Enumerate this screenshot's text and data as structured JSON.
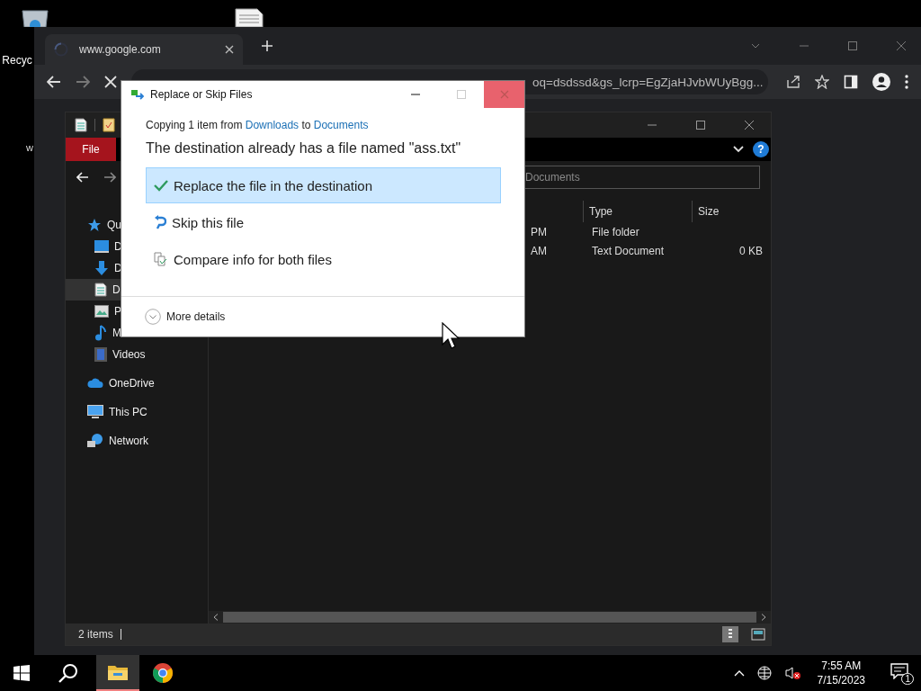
{
  "desktop": {
    "icons": [
      {
        "kind": "recycle",
        "label": "Recyc"
      },
      {
        "kind": "document"
      }
    ],
    "stray_label": "w"
  },
  "browser": {
    "tab": {
      "title": "www.google.com",
      "loading": true
    },
    "address": "oq=dsdssd&gs_lcrp=EgZjaHJvbWUyBgg..."
  },
  "explorer": {
    "ribbon_tab": "File",
    "help": "?",
    "search_placeholder": "Documents",
    "sidebar": [
      {
        "label": "Qu",
        "kind": "star",
        "selected": false,
        "children": [
          {
            "label": "D",
            "kind": "desktop",
            "selected": false
          },
          {
            "label": "D",
            "kind": "download",
            "selected": false
          },
          {
            "label": "D",
            "kind": "docs",
            "selected": true
          },
          {
            "label": "P",
            "kind": "pictures",
            "selected": false
          },
          {
            "label": "M",
            "kind": "music",
            "selected": false
          },
          {
            "label": "Videos",
            "kind": "videos",
            "selected": false
          }
        ]
      },
      {
        "label": "OneDrive",
        "kind": "cloud",
        "selected": false
      },
      {
        "label": "This PC",
        "kind": "pc",
        "selected": false
      },
      {
        "label": "Network",
        "kind": "network",
        "selected": false
      }
    ],
    "columns": [
      "Type",
      "Size"
    ],
    "rows": [
      {
        "date": "PM",
        "type": "File folder"
      },
      {
        "date": "AM",
        "type": "Text Document",
        "size": "0 KB"
      }
    ],
    "status": "2 items"
  },
  "dialog": {
    "title": "Replace or Skip Files",
    "copying": {
      "prefix": "Copying 1 item from",
      "source": "Downloads",
      "middle": "to",
      "target": "Documents"
    },
    "heading": "The destination already has a file named \"ass.txt\"",
    "options": [
      {
        "kind": "replace",
        "label": "Replace the file in the destination",
        "selected": true
      },
      {
        "kind": "skip",
        "label": "Skip this file",
        "selected": false
      },
      {
        "kind": "compare",
        "label": "Compare info for both files",
        "selected": false
      }
    ],
    "more_details": "More details"
  },
  "taskbar": {
    "apps": [
      {
        "kind": "explorer",
        "active": true
      },
      {
        "kind": "chrome",
        "active": false
      }
    ],
    "time": "7:55 AM",
    "date": "7/15/2023",
    "notifications": "1"
  }
}
